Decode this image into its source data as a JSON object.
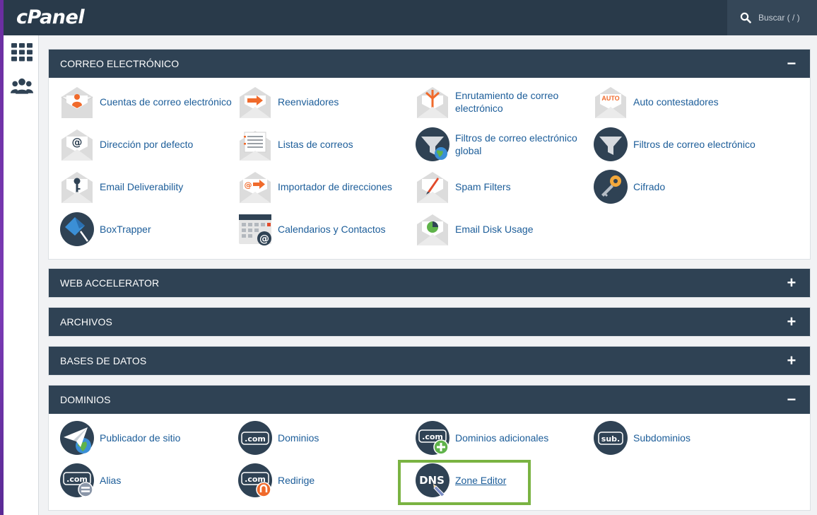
{
  "app": {
    "logo": "cPanel",
    "search_placeholder": "Buscar ( / )"
  },
  "sidebar": {
    "items": [
      {
        "name": "apps-grid-icon"
      },
      {
        "name": "users-icon"
      }
    ]
  },
  "panels": {
    "email": {
      "title": "CORREO ELECTRÓNICO",
      "toggle": "−",
      "items": [
        {
          "label": "Cuentas de correo electrónico",
          "icon": "email-account-icon"
        },
        {
          "label": "Reenviadores",
          "icon": "forwarder-icon"
        },
        {
          "label": "Enrutamiento de correo electrónico",
          "icon": "email-routing-icon"
        },
        {
          "label": "Auto contestadores",
          "icon": "autoresponder-icon",
          "badge": "AUTO"
        },
        {
          "label": "Dirección por defecto",
          "icon": "default-address-icon"
        },
        {
          "label": "Listas de correos",
          "icon": "mailing-list-icon"
        },
        {
          "label": "Filtros de correo electrónico global",
          "icon": "global-filter-icon"
        },
        {
          "label": "Filtros de correo electrónico",
          "icon": "email-filter-icon"
        },
        {
          "label": "Email Deliverability",
          "icon": "deliverability-icon"
        },
        {
          "label": "Importador de direcciones",
          "icon": "address-importer-icon"
        },
        {
          "label": "Spam Filters",
          "icon": "spam-filter-icon"
        },
        {
          "label": "Cifrado",
          "icon": "encryption-key-icon"
        },
        {
          "label": "BoxTrapper",
          "icon": "boxtrapper-icon"
        },
        {
          "label": "Calendarios y Contactos",
          "icon": "calendar-icon"
        },
        {
          "label": "Email Disk Usage",
          "icon": "disk-usage-icon"
        }
      ]
    },
    "web_accelerator": {
      "title": "WEB ACCELERATOR",
      "toggle": "+"
    },
    "archivos": {
      "title": "ARCHIVOS",
      "toggle": "+"
    },
    "bases_datos": {
      "title": "BASES DE DATOS",
      "toggle": "+"
    },
    "dominios": {
      "title": "DOMINIOS",
      "toggle": "−",
      "items": [
        {
          "label": "Publicador de sitio",
          "icon": "site-publisher-icon"
        },
        {
          "label": "Dominios",
          "icon": "domains-icon",
          "badge": ".com"
        },
        {
          "label": "Dominios adicionales",
          "icon": "addon-domains-icon",
          "badge": ".com"
        },
        {
          "label": "Subdominios",
          "icon": "subdomains-icon",
          "badge": "sub."
        },
        {
          "label": "Alias",
          "icon": "alias-icon",
          "badge": ".com"
        },
        {
          "label": "Redirige",
          "icon": "redirects-icon",
          "badge": ".com"
        },
        {
          "label": "Zone Editor",
          "icon": "dns-zone-editor-icon",
          "badge": "DNS"
        }
      ]
    }
  },
  "colors": {
    "topbar": "#293a4a",
    "panel_header": "#2f4254",
    "link": "#1c5d99",
    "highlight": "#7ab342",
    "accent_orange": "#f06a2b"
  }
}
